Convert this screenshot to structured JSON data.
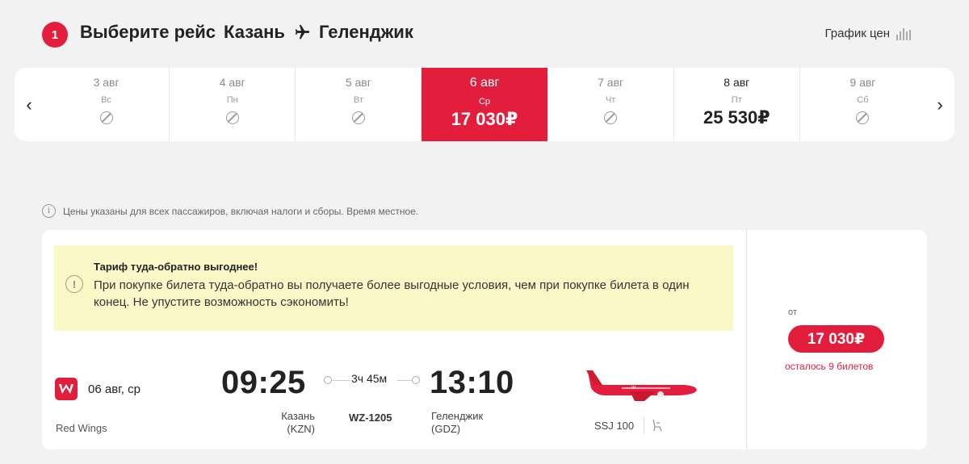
{
  "header": {
    "step_number": "1",
    "title_prefix": "Выберите рейс",
    "origin": "Казань",
    "destination": "Геленджик",
    "price_chart_label": "График цен"
  },
  "date_strip": {
    "prev_icon": "chevron-left-icon",
    "next_icon": "chevron-right-icon",
    "dates": [
      {
        "date": "3 авг",
        "weekday": "Вс",
        "price": null,
        "available": false,
        "selected": false
      },
      {
        "date": "4 авг",
        "weekday": "Пн",
        "price": null,
        "available": false,
        "selected": false
      },
      {
        "date": "5 авг",
        "weekday": "Вт",
        "price": null,
        "available": false,
        "selected": false
      },
      {
        "date": "6 авг",
        "weekday": "Ср",
        "price": "17 030₽",
        "available": true,
        "selected": true
      },
      {
        "date": "7 авг",
        "weekday": "Чт",
        "price": null,
        "available": false,
        "selected": false
      },
      {
        "date": "8 авг",
        "weekday": "Пт",
        "price": "25 530₽",
        "available": true,
        "selected": false
      },
      {
        "date": "9 авг",
        "weekday": "Сб",
        "price": null,
        "available": false,
        "selected": false
      }
    ]
  },
  "info_note": "Цены указаны для всех пассажиров, включая налоги и сборы. Время местное.",
  "promo": {
    "title": "Тариф туда-обратно выгоднее!",
    "text": "При покупке билета туда-обратно вы получаете более выгодные условия, чем при покупке билета в один конец. Не упустите возможность сэкономить!"
  },
  "flight": {
    "date": "06 авг, ср",
    "airline": "Red Wings",
    "departure_time": "09:25",
    "arrival_time": "13:10",
    "duration": "3ч 45м",
    "departure_city": "Казань",
    "departure_code": "(KZN)",
    "arrival_city": "Геленджик",
    "arrival_code": "(GDZ)",
    "flight_number": "WZ-1205",
    "aircraft": "SSJ 100",
    "price_from_label": "от",
    "price": "17 030₽",
    "tickets_left": "осталось 9 билетов"
  },
  "colors": {
    "accent": "#e31e3c",
    "promo_bg": "#fbf8c8",
    "page_bg": "#f2f2f2"
  }
}
